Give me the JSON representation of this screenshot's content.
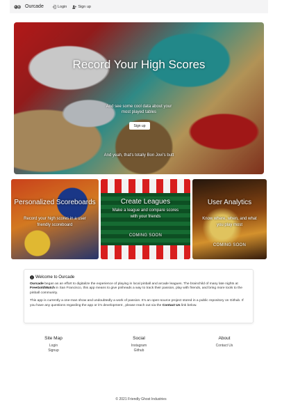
{
  "navbar": {
    "brand": "Ourcade",
    "links": [
      {
        "label": "Login",
        "icon": "login-icon"
      },
      {
        "label": "Sign up",
        "icon": "user-plus-icon"
      }
    ]
  },
  "hero": {
    "title": "Record Your High Scores",
    "subtitle": "And see some cool data about your most played tables",
    "button_label": "Sign up",
    "caption": "And yeah, that's totally Bon Jovi's butt"
  },
  "features": [
    {
      "title": "Personalized Scoreboards",
      "text": "Record your high scores in a user friendly scoreboard",
      "badge": ""
    },
    {
      "title": "Create Leagues",
      "text": "Make a league and compare scores with your friends",
      "badge": "COMING SOON"
    },
    {
      "title": "User Analytics",
      "text": "Know where, when, and what you play most",
      "badge": "COMING SOON"
    }
  ],
  "welcome": {
    "heading": "Welcome to Ourcade",
    "p1_brand": "Ourcade",
    "p1_a": " began as an effort to digitalize the experience of playing in local pinball and arcade leagues. The brainchild of many late nights at ",
    "p1_place": "FreeGoldWatch",
    "p1_b": " in San Francisco, this app means to give pinheads a way to track their passion, play with friends, and bring more tools to the pinball community.",
    "p2_a": "This app is currently a one-man show and undoubtedly a work of passion. It's an open-source project stored in a public repository on Github. If you have any questions regarding the app or it's development , please reach out via the ",
    "p2_link": "Contact Us",
    "p2_b": " link below."
  },
  "footer": {
    "columns": [
      {
        "heading": "Site Map",
        "links": [
          "Login",
          "Signup"
        ]
      },
      {
        "heading": "Social",
        "links": [
          "Instagram",
          "Github"
        ]
      },
      {
        "heading": "About",
        "links": [
          "Contact Us"
        ]
      }
    ],
    "copyright": "© 2021 Friendly Ghost Industries"
  }
}
